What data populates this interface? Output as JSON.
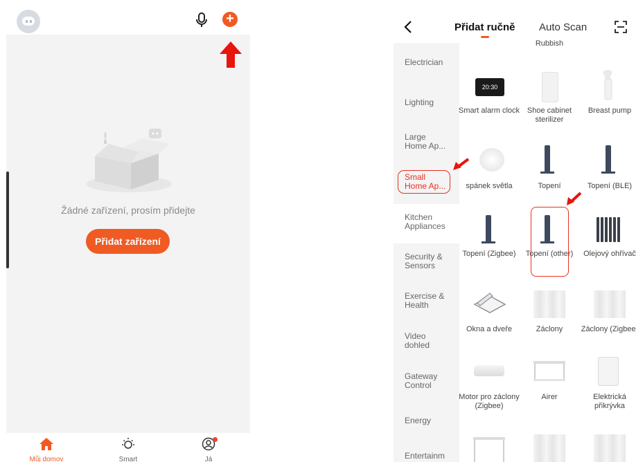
{
  "left_screen": {
    "empty_text": "Žádné zařízení, prosím přidejte",
    "add_device_label": "Přidat zařízení",
    "nav": {
      "home": "Můj domov",
      "smart": "Smart",
      "me": "Já"
    },
    "icons": [
      "avatar-icon",
      "microphone-icon",
      "add-icon",
      "arrow-up-icon",
      "home-icon",
      "sun-icon",
      "user-icon"
    ]
  },
  "right_screen": {
    "tabs": {
      "manual": "Přidat ručně",
      "auto_scan": "Auto Scan"
    },
    "partial_top_label": "Rubbish",
    "categories": [
      "Electrician",
      "Lighting",
      "Large Home Ap...",
      "Small Home Ap...",
      "Kitchen Appliances",
      "Security & Sensors",
      "Exercise & Health",
      "Video dohled",
      "Gateway Control",
      "Energy",
      "Entertainm"
    ],
    "selected_category": "Small Home Ap...",
    "devices": [
      "Smart alarm clock",
      "Shoe cabinet sterilizer",
      "Breast pump",
      "spánek světla",
      "Topení",
      "Topení (BLE)",
      "Topení (Zigbee)",
      "Topení (other)",
      "Olejový ohřívač",
      "Okna a dveře",
      "Záclony",
      "Záclony (Zigbee)",
      "Motor pro záclony (Zigbee)",
      "Airer",
      "Elektrická přikrývka"
    ],
    "alarm_clock_display": "20:30",
    "highlight_color": "#e43223",
    "accent_color": "#f05a23"
  }
}
